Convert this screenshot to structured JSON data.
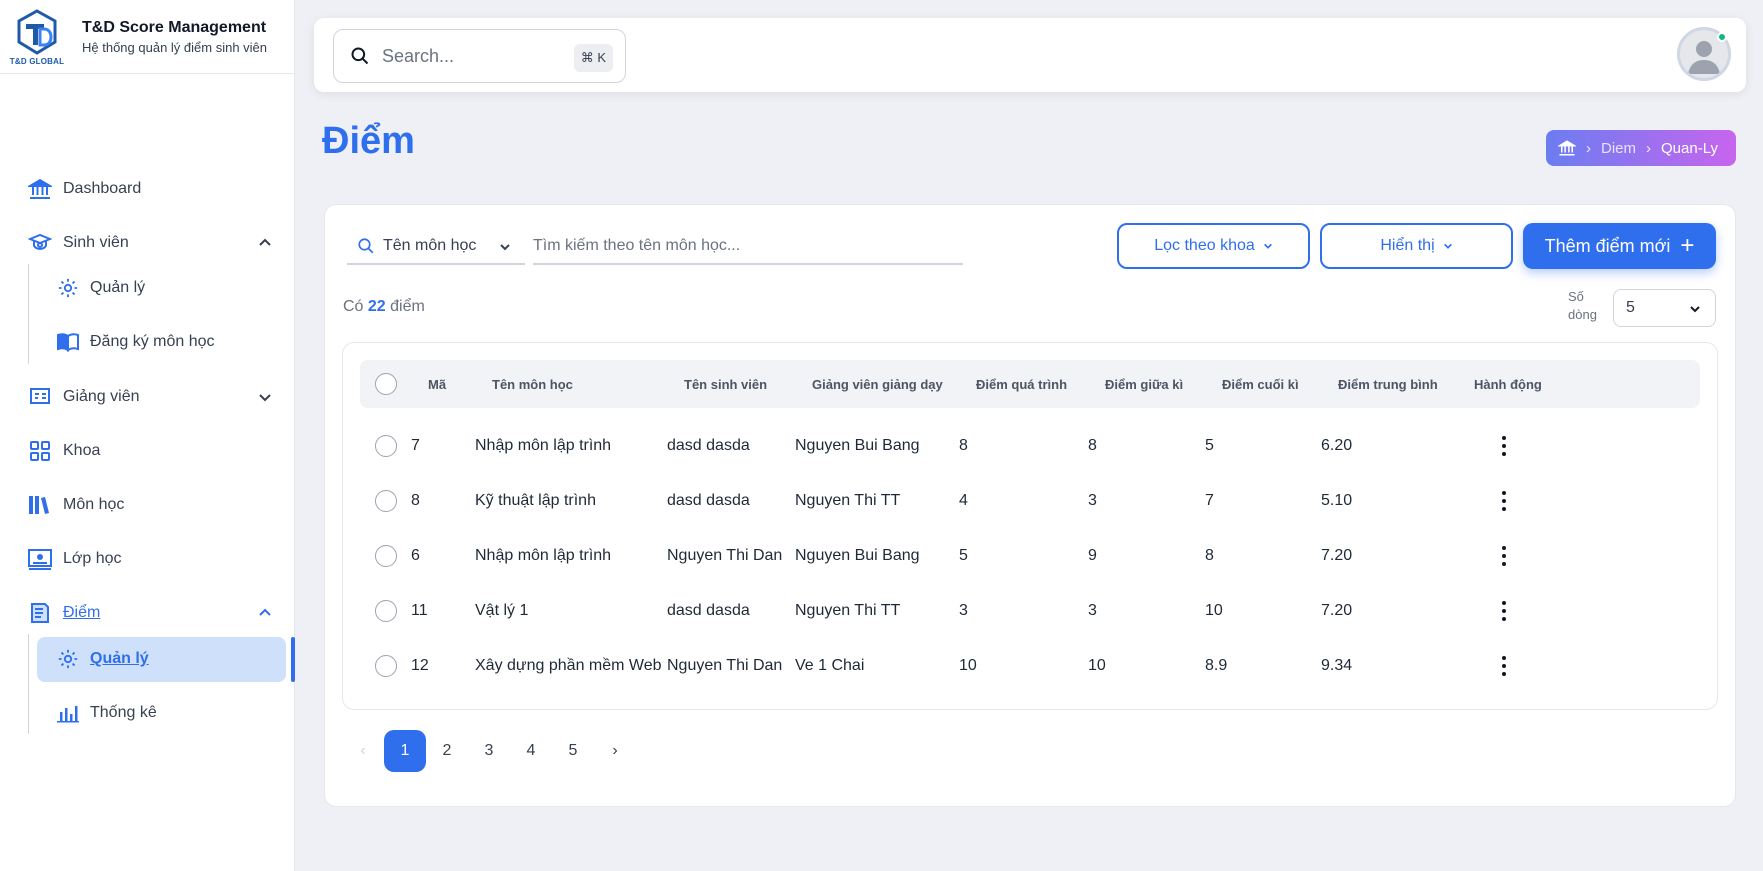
{
  "brand": {
    "logo_text": "T&D GLOBAL",
    "title": "T&D Score Management",
    "subtitle": "Hệ thống quản lý điểm sinh viên"
  },
  "sidebar": {
    "dashboard": "Dashboard",
    "sinh_vien": {
      "label": "Sinh viên",
      "children": [
        "Quản lý",
        "Đăng ký môn học"
      ]
    },
    "giang_vien": "Giảng viên",
    "khoa": "Khoa",
    "mon_hoc": "Môn học",
    "lop_hoc": "Lớp học",
    "diem": {
      "label": "Điểm",
      "children": [
        "Quản lý",
        "Thống kê"
      ]
    }
  },
  "topbar": {
    "search_placeholder": "Search...",
    "shortcut": "⌘ K"
  },
  "page": {
    "title": "Điểm",
    "breadcrumb": [
      "Diem",
      "Quan-Ly"
    ]
  },
  "toolbar": {
    "filter_field": "Tên môn học",
    "search_placeholder": "Tìm kiếm theo tên môn học...",
    "filter_faculty": "Lọc theo khoa",
    "display": "Hiển thị",
    "add_new": "Thêm điểm mới"
  },
  "summary": {
    "prefix": "Có",
    "count": "22",
    "suffix": "điểm",
    "rows_label_1": "Số",
    "rows_label_2": "dòng",
    "rows_value": "5"
  },
  "table": {
    "columns": [
      "Mã",
      "Tên môn học",
      "Tên sinh viên",
      "Giảng viên giảng dạy",
      "Điểm quá trình",
      "Điểm giữa kì",
      "Điểm cuối kì",
      "Điểm trung bình",
      "Hành động"
    ],
    "rows": [
      [
        "7",
        "Nhập môn lập trình",
        "dasd dasda",
        "Nguyen Bui Bang",
        "8",
        "8",
        "5",
        "6.20"
      ],
      [
        "8",
        "Kỹ thuật lập trình",
        "dasd dasda",
        "Nguyen Thi TT",
        "4",
        "3",
        "7",
        "5.10"
      ],
      [
        "6",
        "Nhập môn lập trình",
        "Nguyen Thi Dan",
        "Nguyen Bui Bang",
        "5",
        "9",
        "8",
        "7.20"
      ],
      [
        "11",
        "Vật lý 1",
        "dasd dasda",
        "Nguyen Thi TT",
        "3",
        "3",
        "10",
        "7.20"
      ],
      [
        "12",
        "Xây dựng phần mềm Web",
        "Nguyen Thi Dan",
        "Ve 1 Chai",
        "10",
        "10",
        "8.9",
        "9.34"
      ]
    ]
  },
  "pagination": {
    "pages": [
      "1",
      "2",
      "3",
      "4",
      "5"
    ],
    "active": "1"
  },
  "colors": {
    "accent": "#2f6fed",
    "breadcrumb_gradient": [
      "#6b7df0",
      "#c765ee"
    ],
    "online": "#10b981"
  },
  "icons": {
    "search": "search-icon",
    "dashboard": "bank-icon",
    "student": "graduation-icon",
    "manage": "gear-icon",
    "register": "open-book-icon",
    "lecturer": "presentation-icon",
    "faculty": "grid-icon",
    "subject": "books-icon",
    "class": "classroom-icon",
    "score": "notebook-icon",
    "stats": "bar-chart-icon",
    "more": "kebab-icon"
  }
}
